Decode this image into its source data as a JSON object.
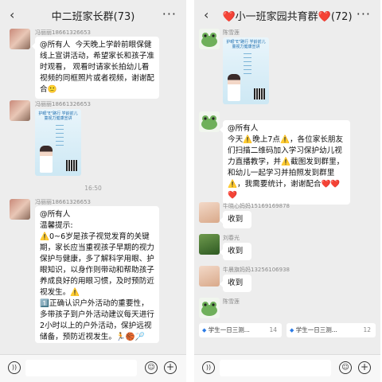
{
  "left": {
    "title": "中二班家长群(73)",
    "back": "‹",
    "more": "···",
    "messages": [
      {
        "name": "冯丽丽18661326653",
        "text": "@所有人  今天晚上学龄前眼保健线上宣讲活动，希望家长和孩子准时观看， 观看时请家长拍幼儿看视频的同框照片或者视频，谢谢配合🙂"
      },
      {
        "name": "冯丽丽18661326653",
        "poster_text": "护眼\"E\"路行 学龄前儿童视力健康宣讲"
      },
      {
        "time": "16:50"
      },
      {
        "name": "冯丽丽18661326653",
        "text": "@所有人\n温馨提示:\n⚠️0~6岁是孩子视觉发育的关键期，家长应当重视孩子早期的视力保护与健康，多了解科学用眼、护眼知识，以身作则带动和帮助孩子养成良好的用眼习惯，及时预防近视发生。⚠️\n1️⃣正确认识户外活动的重要性，多带孩子到户外活动建议每天进行2小时以上的户外活动，保护远视储备，预防近视发生。🏃🏀🏸"
      }
    ]
  },
  "right": {
    "title_pre": "❤️",
    "title": "小一班家园共育群",
    "title_post": "❤️(72)",
    "back": "‹",
    "more": "···",
    "messages": [
      {
        "name": "陈雪莲",
        "poster_text": "护眼\"E\"路行 学龄前儿童视力健康宣讲"
      },
      {
        "name": "",
        "text": "@所有人\n今天⚠️晚上7点⚠️，各位家长朋友们扫描二维码加入学习保护幼儿视力直播教学，并⚠️截图发到群里，和幼儿一起学习并拍照发到群里⚠️，我需要统计，谢谢配合❤️❤️❤️"
      },
      {
        "name": "牛晓心妈妈15169169878",
        "text": "收到"
      },
      {
        "name": "刘春光",
        "text": "收到"
      },
      {
        "name": "牛晨旗妈妈13256106938",
        "text": "收到"
      },
      {
        "name": "陈雪莲",
        "text": ""
      }
    ],
    "chips": [
      {
        "label": "学生一日三测...",
        "count": "14"
      },
      {
        "label": "学生一日三测...",
        "count": "12"
      }
    ]
  },
  "colors": {
    "background": "#ededed",
    "bubble": "#ffffff",
    "heart": "#e0303a",
    "chip_icon": "#2c7be5"
  },
  "icons": [
    "back-icon",
    "more-icon",
    "voice-icon",
    "emoji-icon",
    "plus-icon",
    "poll-icon"
  ]
}
